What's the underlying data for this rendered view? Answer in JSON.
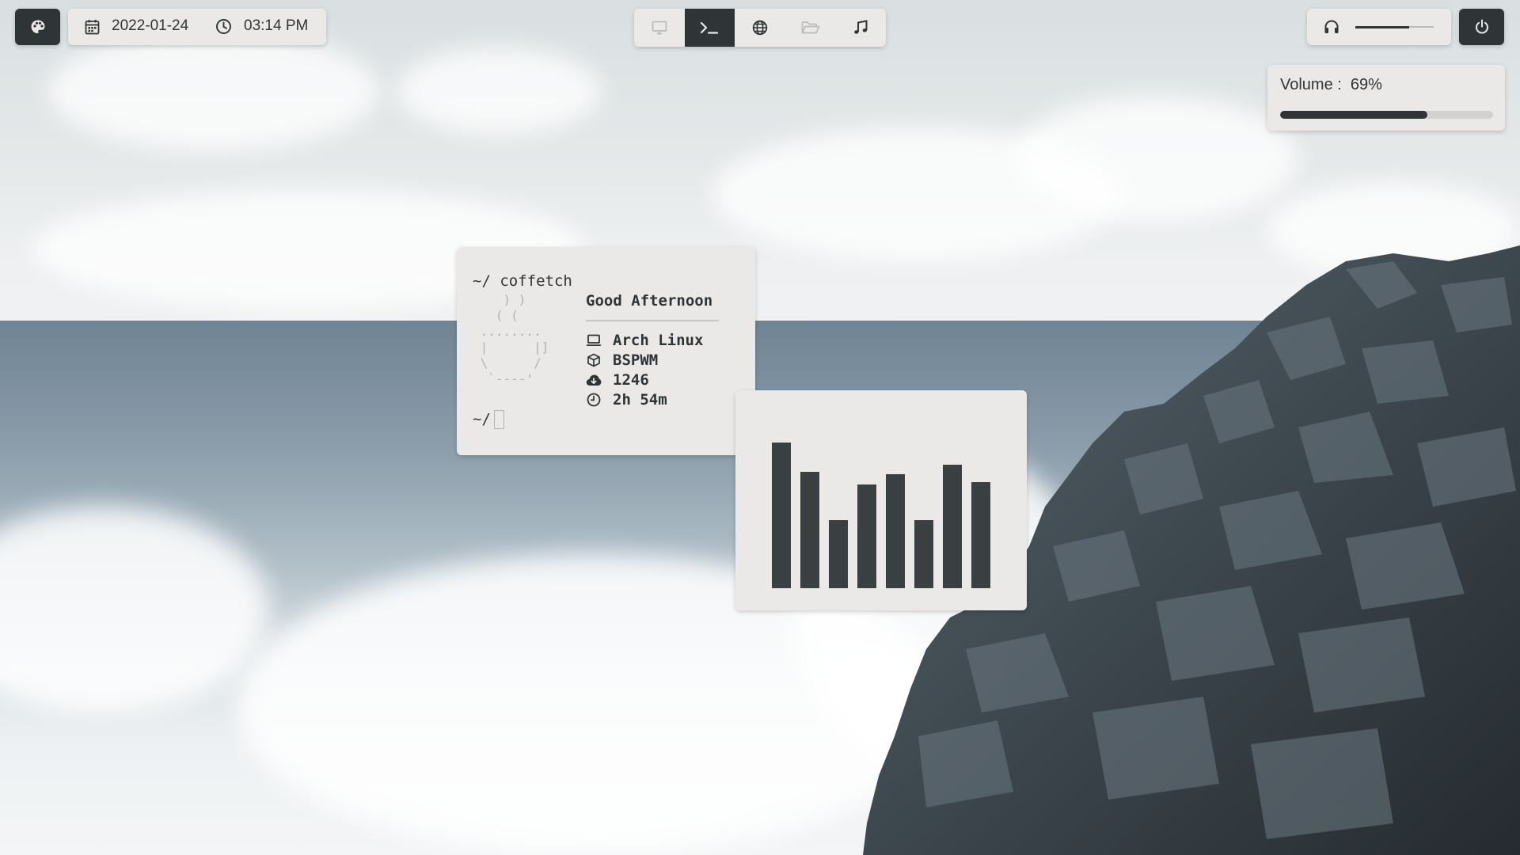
{
  "topbar": {
    "left": {
      "theme_icon": "palette-icon",
      "date": "2022-01-24",
      "time": "03:14 PM"
    },
    "workspaces": [
      {
        "icon": "monitor-icon",
        "active": false,
        "dimmed": true
      },
      {
        "icon": "terminal-icon",
        "active": true,
        "dimmed": false
      },
      {
        "icon": "globe-icon",
        "active": false,
        "dimmed": false
      },
      {
        "icon": "folder-icon",
        "active": false,
        "dimmed": true
      },
      {
        "icon": "music-note-icon",
        "active": false,
        "dimmed": false
      }
    ],
    "right": {
      "audio_icon": "headphones-icon",
      "volume_level": 0.69,
      "power_icon": "power-icon"
    }
  },
  "volume_popup": {
    "label": "Volume :  69%",
    "value": 69
  },
  "terminal": {
    "command_line": "~/ coffetch",
    "prompt": "~/",
    "greeting": "Good Afternoon",
    "info": [
      {
        "icon": "laptop-icon",
        "text": "Arch Linux"
      },
      {
        "icon": "cube-icon",
        "text": "BSPWM"
      },
      {
        "icon": "cloud-download-icon",
        "text": "1246"
      },
      {
        "icon": "clock-icon",
        "text": "2h 54m"
      }
    ]
  },
  "visualizer": {
    "levels": [
      1.0,
      0.8,
      0.47,
      0.71,
      0.78,
      0.47,
      0.85,
      0.73
    ]
  },
  "colors": {
    "panel_bg": "#ebe9e8",
    "accent_dark": "#2f3437",
    "muted": "#b5b3b2"
  }
}
